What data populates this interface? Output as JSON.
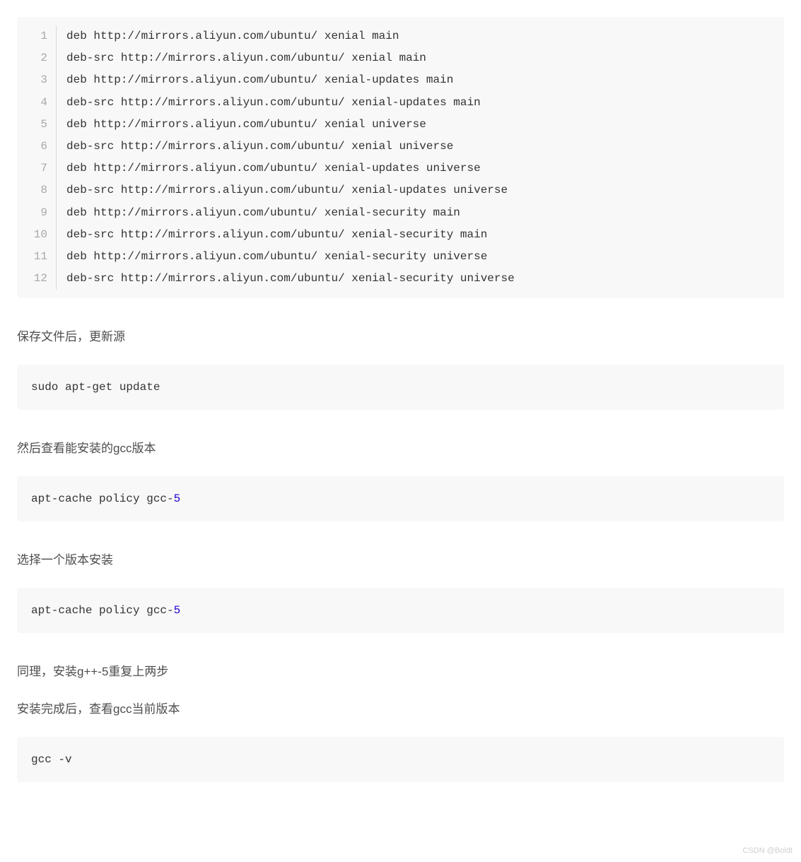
{
  "sources_block": {
    "lines": [
      "deb http://mirrors.aliyun.com/ubuntu/ xenial main",
      "deb-src http://mirrors.aliyun.com/ubuntu/ xenial main",
      "deb http://mirrors.aliyun.com/ubuntu/ xenial-updates main",
      "deb-src http://mirrors.aliyun.com/ubuntu/ xenial-updates main",
      "deb http://mirrors.aliyun.com/ubuntu/ xenial universe",
      "deb-src http://mirrors.aliyun.com/ubuntu/ xenial universe",
      "deb http://mirrors.aliyun.com/ubuntu/ xenial-updates universe",
      "deb-src http://mirrors.aliyun.com/ubuntu/ xenial-updates universe",
      "deb http://mirrors.aliyun.com/ubuntu/ xenial-security main",
      "deb-src http://mirrors.aliyun.com/ubuntu/ xenial-security main",
      "deb http://mirrors.aliyun.com/ubuntu/ xenial-security universe",
      "deb-src http://mirrors.aliyun.com/ubuntu/ xenial-security universe"
    ]
  },
  "para1": "保存文件后，更新源",
  "cmd1": "sudo apt-get update",
  "para2": "然后查看能安装的gcc版本",
  "cmd2_prefix": "apt-cache policy gcc-",
  "cmd2_num": "5",
  "para3": "选择一个版本安装",
  "cmd3_prefix": "apt-cache policy gcc-",
  "cmd3_num": "5",
  "para4": "同理，安装g++-5重复上两步",
  "para5": "安装完成后，查看gcc当前版本",
  "cmd4": "gcc -v",
  "watermark": "CSDN @Boldt"
}
